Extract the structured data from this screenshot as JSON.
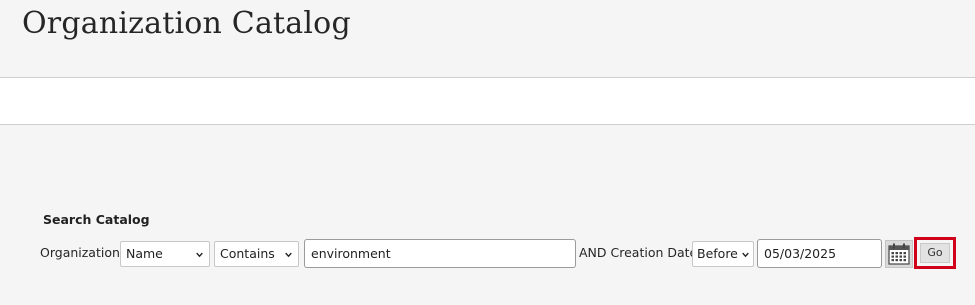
{
  "page": {
    "title": "Organization Catalog"
  },
  "search": {
    "heading": "Search Catalog",
    "field_label": "Organization",
    "field_select": "Name",
    "operator_select": "Contains",
    "query_value": "environment",
    "date_label": "AND Creation Date",
    "date_operator_select": "Before",
    "date_value": "05/03/2025",
    "go_label": "Go"
  },
  "icons": {
    "calendar": "calendar-icon",
    "chevron": "chevron-down-icon"
  },
  "colors": {
    "highlight_border": "#d0021b",
    "background": "#f5f5f5"
  }
}
